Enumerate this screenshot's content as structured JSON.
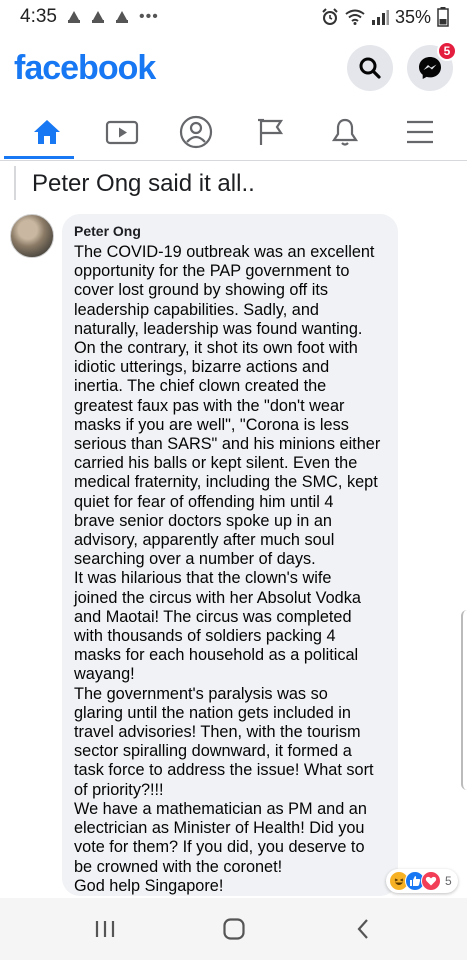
{
  "status_bar": {
    "time": "4:35",
    "dots": "•••",
    "battery": "35%"
  },
  "header": {
    "logo": "facebook",
    "messenger_badge": "5",
    "brand_color": "#1877f2"
  },
  "nav": {
    "items": [
      "home-icon",
      "watch-icon",
      "profile-icon",
      "pages-flag-icon",
      "notifications-bell-icon",
      "menu-icon"
    ],
    "active": "home-icon"
  },
  "post": {
    "text": "Peter Ong said it all.."
  },
  "comment": {
    "author": "Peter Ong",
    "body": "The COVID-19 outbreak was an excellent\nopportunity for the PAP government to\ncover lost ground by showing off its\nleadership capabilities. Sadly, and\nnaturally, leadership was found wanting.\nOn the contrary, it shot its own foot with\nidiotic utterings, bizarre actions and\ninertia. The chief clown created the\ngreatest faux pas with the \"don't wear\nmasks if you are well\", \"Corona is less\nserious than SARS\" and his minions either\ncarried his balls or kept silent. Even the\nmedical fraternity, including the SMC, kept\nquiet for fear of offending him until 4\nbrave senior doctors spoke up in an\nadvisory, apparently after much soul\nsearching over a number of days.\nIt was hilarious that the clown's wife\njoined the circus with her Absolut Vodka\nand Maotai! The circus was completed\nwith thousands of soldiers packing 4\nmasks for each household as a political\nwayang!\nThe government's paralysis was so\nglaring until the nation gets included in\ntravel advisories! Then, with the tourism\nsector spiralling downward, it formed a\ntask force to address the issue! What sort\nof priority?!!!\nWe have a mathematician as PM and an\nelectrician as Minister of Health! Did you\nvote for them? If you did, you deserve to\nbe crowned with the coronet!\nGod help Singapore!",
    "reactions": {
      "types": [
        "haha",
        "like",
        "love"
      ],
      "count": "5"
    }
  },
  "android_nav": {
    "buttons": [
      "recent-apps",
      "home",
      "back"
    ]
  }
}
